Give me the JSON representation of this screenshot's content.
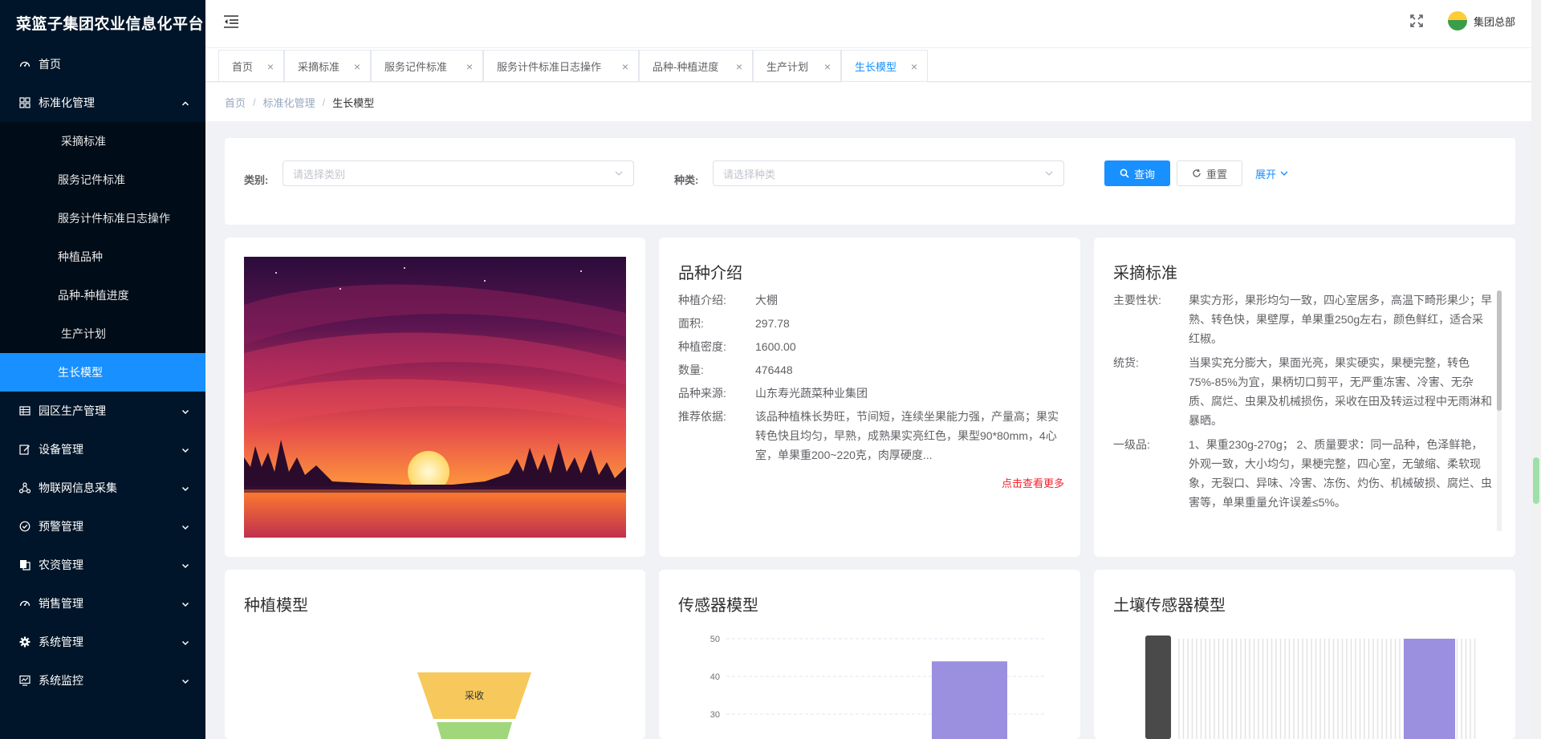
{
  "app": {
    "title": "菜篮子集团农业信息化平台",
    "user": "集团总部"
  },
  "sidebar": {
    "items": [
      {
        "label": "首页",
        "icon": "dashboard-icon"
      },
      {
        "label": "标准化管理",
        "icon": "grid-icon",
        "expanded": true
      },
      {
        "label": "园区生产管理",
        "icon": "table-icon"
      },
      {
        "label": "设备管理",
        "icon": "edit-icon"
      },
      {
        "label": "物联网信息采集",
        "icon": "network-icon"
      },
      {
        "label": "预警管理",
        "icon": "check-circle-icon"
      },
      {
        "label": "农资管理",
        "icon": "copy-icon"
      },
      {
        "label": "销售管理",
        "icon": "dashboard-icon"
      },
      {
        "label": "系统管理",
        "icon": "gear-icon"
      },
      {
        "label": "系统监控",
        "icon": "monitor-icon"
      }
    ],
    "sub_items": [
      {
        "label": "采摘标准"
      },
      {
        "label": "服务记件标准"
      },
      {
        "label": "服务计件标准日志操作"
      },
      {
        "label": "种植品种"
      },
      {
        "label": "品种-种植进度"
      },
      {
        "label": "生产计划"
      },
      {
        "label": "生长模型",
        "active": true
      }
    ]
  },
  "tabs": [
    {
      "label": "首页"
    },
    {
      "label": "采摘标准"
    },
    {
      "label": "服务记件标准"
    },
    {
      "label": "服务计件标准日志操作"
    },
    {
      "label": "品种-种植进度"
    },
    {
      "label": "生产计划"
    },
    {
      "label": "生长模型",
      "active": true
    }
  ],
  "breadcrumb": [
    "首页",
    "标准化管理",
    "生长模型"
  ],
  "search": {
    "category_label": "类别:",
    "category_placeholder": "请选择类别",
    "kind_label": "种类:",
    "kind_placeholder": "请选择种类",
    "query_button": "查询",
    "reset_button": "重置",
    "expand_button": "展开"
  },
  "variety": {
    "title": "品种介绍",
    "rows": [
      {
        "key": "种植介绍:",
        "value": "大棚"
      },
      {
        "key": "面积:",
        "value": "297.78"
      },
      {
        "key": "种植密度:",
        "value": "1600.00"
      },
      {
        "key": "数量:",
        "value": "476448"
      },
      {
        "key": "品种来源:",
        "value": "山东寿光蔬菜种业集团"
      },
      {
        "key": "推荐依据:",
        "value": "该品种植株长势旺，节间短，连续坐果能力强，产量高；果实转色快且均匀，早熟，成熟果实亮红色，果型90*80mm，4心室，单果重200~220克，肉厚硬度..."
      }
    ],
    "more_link": "点击查看更多"
  },
  "picking": {
    "title": "采摘标准",
    "rows": [
      {
        "key": "主要性状:",
        "value": "果实方形，果形均匀一致，四心室居多，高温下畸形果少；早熟、转色快，果壁厚，单果重250g左右，颜色鲜红，适合采红椒。"
      },
      {
        "key": "统货:",
        "value": "当果实充分膨大，果面光亮，果实硬实，果梗完整，转色75%-85%为宜，果柄切口剪平，无严重冻害、冷害、无杂质、腐烂、虫果及机械损伤，采收在田及转运过程中无雨淋和暴晒。"
      },
      {
        "key": "一级品:",
        "value": "1、果重230g-270g； 2、质量要求：同一品种，色泽鲜艳，外观一致，大小均匀，果梗完整，四心室，无皱缩、柔软现象，无裂口、异味、冷害、冻伤、灼伤、机械破损、腐烂、虫害等，单果重量允许误差≤5%。"
      }
    ]
  },
  "planting_model": {
    "title": "种植模型",
    "funnel_labels": [
      "采收"
    ],
    "colors": [
      "#f7c95c",
      "#9fd77a"
    ]
  },
  "sensor_model": {
    "title": "传感器模型",
    "chart_data": {
      "type": "bar",
      "ylim": [
        30,
        50
      ],
      "yticks": [
        50,
        40,
        30
      ],
      "values": [
        44
      ],
      "color": "#9b8fe0"
    }
  },
  "soil_model": {
    "title": "土壤传感器模型",
    "chart_data": {
      "type": "bar",
      "ylim": [
        0,
        50
      ],
      "values": [
        50
      ],
      "color": "#9b8fe0"
    }
  }
}
